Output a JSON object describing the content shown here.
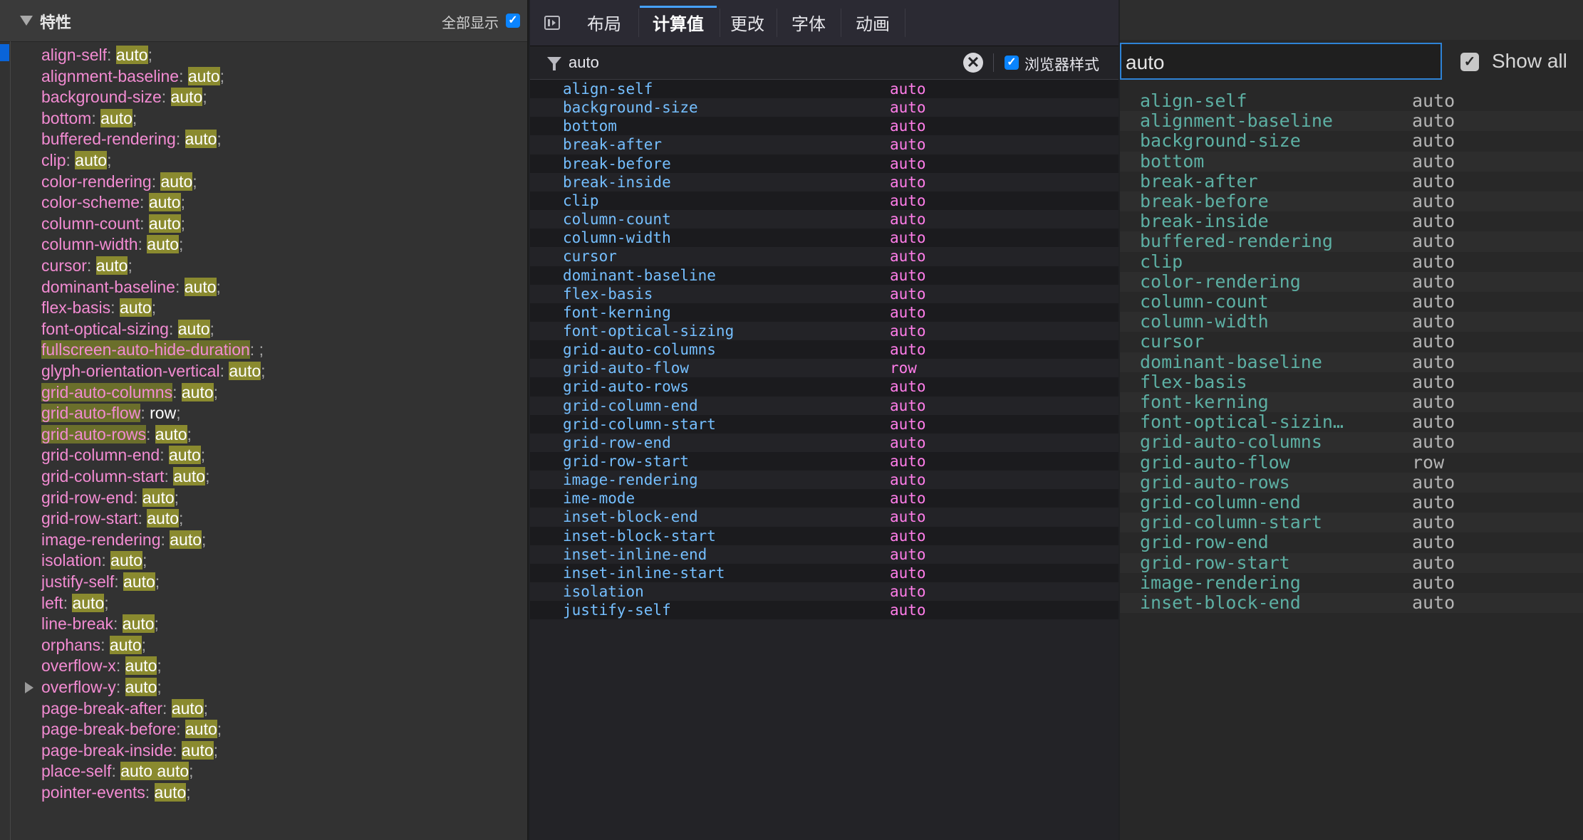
{
  "panel1": {
    "title": "特性",
    "show_all_label": "全部显示",
    "show_all_checked": true,
    "items": [
      {
        "name": "align-self",
        "value": "auto",
        "name_hl": false,
        "value_hl": true
      },
      {
        "name": "alignment-baseline",
        "value": "auto",
        "name_hl": false,
        "value_hl": true
      },
      {
        "name": "background-size",
        "value": "auto",
        "name_hl": false,
        "value_hl": true
      },
      {
        "name": "bottom",
        "value": "auto",
        "name_hl": false,
        "value_hl": true
      },
      {
        "name": "buffered-rendering",
        "value": "auto",
        "name_hl": false,
        "value_hl": true
      },
      {
        "name": "clip",
        "value": "auto",
        "name_hl": false,
        "value_hl": true
      },
      {
        "name": "color-rendering",
        "value": "auto",
        "name_hl": false,
        "value_hl": true
      },
      {
        "name": "color-scheme",
        "value": "auto",
        "name_hl": false,
        "value_hl": true
      },
      {
        "name": "column-count",
        "value": "auto",
        "name_hl": false,
        "value_hl": true
      },
      {
        "name": "column-width",
        "value": "auto",
        "name_hl": false,
        "value_hl": true
      },
      {
        "name": "cursor",
        "value": "auto",
        "name_hl": false,
        "value_hl": true
      },
      {
        "name": "dominant-baseline",
        "value": "auto",
        "name_hl": false,
        "value_hl": true
      },
      {
        "name": "flex-basis",
        "value": "auto",
        "name_hl": false,
        "value_hl": true
      },
      {
        "name": "font-optical-sizing",
        "value": "auto",
        "name_hl": false,
        "value_hl": true
      },
      {
        "name": "fullscreen-auto-hide-duration",
        "value": "",
        "name_hl": true,
        "value_hl": false
      },
      {
        "name": "glyph-orientation-vertical",
        "value": "auto",
        "name_hl": false,
        "value_hl": true
      },
      {
        "name": "grid-auto-columns",
        "value": "auto",
        "name_hl": true,
        "value_hl": true
      },
      {
        "name": "grid-auto-flow",
        "value": "row",
        "name_hl": true,
        "value_hl": false
      },
      {
        "name": "grid-auto-rows",
        "value": "auto",
        "name_hl": true,
        "value_hl": true
      },
      {
        "name": "grid-column-end",
        "value": "auto",
        "name_hl": false,
        "value_hl": true
      },
      {
        "name": "grid-column-start",
        "value": "auto",
        "name_hl": false,
        "value_hl": true
      },
      {
        "name": "grid-row-end",
        "value": "auto",
        "name_hl": false,
        "value_hl": true
      },
      {
        "name": "grid-row-start",
        "value": "auto",
        "name_hl": false,
        "value_hl": true
      },
      {
        "name": "image-rendering",
        "value": "auto",
        "name_hl": false,
        "value_hl": true
      },
      {
        "name": "isolation",
        "value": "auto",
        "name_hl": false,
        "value_hl": true
      },
      {
        "name": "justify-self",
        "value": "auto",
        "name_hl": false,
        "value_hl": true
      },
      {
        "name": "left",
        "value": "auto",
        "name_hl": false,
        "value_hl": true
      },
      {
        "name": "line-break",
        "value": "auto",
        "name_hl": false,
        "value_hl": true
      },
      {
        "name": "orphans",
        "value": "auto",
        "name_hl": false,
        "value_hl": true
      },
      {
        "name": "overflow-x",
        "value": "auto",
        "name_hl": false,
        "value_hl": true
      },
      {
        "name": "overflow-y",
        "value": "auto",
        "name_hl": false,
        "value_hl": true,
        "expandable": true
      },
      {
        "name": "page-break-after",
        "value": "auto",
        "name_hl": false,
        "value_hl": true
      },
      {
        "name": "page-break-before",
        "value": "auto",
        "name_hl": false,
        "value_hl": true
      },
      {
        "name": "page-break-inside",
        "value": "auto",
        "name_hl": false,
        "value_hl": true
      },
      {
        "name": "place-self",
        "value": "auto auto",
        "name_hl": false,
        "value_hl": true
      },
      {
        "name": "pointer-events",
        "value": "auto",
        "name_hl": false,
        "value_hl": true
      }
    ]
  },
  "panel2": {
    "tabs": [
      {
        "label": "布局",
        "active": false
      },
      {
        "label": "计算值",
        "active": true
      },
      {
        "label": "更改",
        "active": false
      },
      {
        "label": "字体",
        "active": false
      },
      {
        "label": "动画",
        "active": false
      }
    ],
    "filter_value": "auto",
    "browser_styles_label": "浏览器样式",
    "browser_styles_checked": true,
    "clear_glyph": "✕",
    "rows": [
      {
        "name": "align-self",
        "value": "auto"
      },
      {
        "name": "background-size",
        "value": "auto"
      },
      {
        "name": "bottom",
        "value": "auto"
      },
      {
        "name": "break-after",
        "value": "auto"
      },
      {
        "name": "break-before",
        "value": "auto"
      },
      {
        "name": "break-inside",
        "value": "auto"
      },
      {
        "name": "clip",
        "value": "auto"
      },
      {
        "name": "column-count",
        "value": "auto"
      },
      {
        "name": "column-width",
        "value": "auto"
      },
      {
        "name": "cursor",
        "value": "auto"
      },
      {
        "name": "dominant-baseline",
        "value": "auto"
      },
      {
        "name": "flex-basis",
        "value": "auto"
      },
      {
        "name": "font-kerning",
        "value": "auto"
      },
      {
        "name": "font-optical-sizing",
        "value": "auto"
      },
      {
        "name": "grid-auto-columns",
        "value": "auto"
      },
      {
        "name": "grid-auto-flow",
        "value": "row"
      },
      {
        "name": "grid-auto-rows",
        "value": "auto"
      },
      {
        "name": "grid-column-end",
        "value": "auto"
      },
      {
        "name": "grid-column-start",
        "value": "auto"
      },
      {
        "name": "grid-row-end",
        "value": "auto"
      },
      {
        "name": "grid-row-start",
        "value": "auto"
      },
      {
        "name": "image-rendering",
        "value": "auto"
      },
      {
        "name": "ime-mode",
        "value": "auto"
      },
      {
        "name": "inset-block-end",
        "value": "auto"
      },
      {
        "name": "inset-block-start",
        "value": "auto"
      },
      {
        "name": "inset-inline-end",
        "value": "auto"
      },
      {
        "name": "inset-inline-start",
        "value": "auto"
      },
      {
        "name": "isolation",
        "value": "auto"
      },
      {
        "name": "justify-self",
        "value": "auto"
      }
    ]
  },
  "panel3": {
    "filter_value": "auto",
    "show_all_label": "Show all",
    "show_all_checked": true,
    "rows": [
      {
        "name": "align-self",
        "value": "auto"
      },
      {
        "name": "alignment-baseline",
        "value": "auto"
      },
      {
        "name": "background-size",
        "value": "auto"
      },
      {
        "name": "bottom",
        "value": "auto"
      },
      {
        "name": "break-after",
        "value": "auto"
      },
      {
        "name": "break-before",
        "value": "auto"
      },
      {
        "name": "break-inside",
        "value": "auto"
      },
      {
        "name": "buffered-rendering",
        "value": "auto"
      },
      {
        "name": "clip",
        "value": "auto"
      },
      {
        "name": "color-rendering",
        "value": "auto"
      },
      {
        "name": "column-count",
        "value": "auto"
      },
      {
        "name": "column-width",
        "value": "auto"
      },
      {
        "name": "cursor",
        "value": "auto"
      },
      {
        "name": "dominant-baseline",
        "value": "auto"
      },
      {
        "name": "flex-basis",
        "value": "auto"
      },
      {
        "name": "font-kerning",
        "value": "auto"
      },
      {
        "name": "font-optical-sizin…",
        "value": "auto"
      },
      {
        "name": "grid-auto-columns",
        "value": "auto"
      },
      {
        "name": "grid-auto-flow",
        "value": "row"
      },
      {
        "name": "grid-auto-rows",
        "value": "auto"
      },
      {
        "name": "grid-column-end",
        "value": "auto"
      },
      {
        "name": "grid-column-start",
        "value": "auto"
      },
      {
        "name": "grid-row-end",
        "value": "auto"
      },
      {
        "name": "grid-row-start",
        "value": "auto"
      },
      {
        "name": "image-rendering",
        "value": "auto"
      },
      {
        "name": "inset-block-end",
        "value": "auto"
      }
    ]
  }
}
